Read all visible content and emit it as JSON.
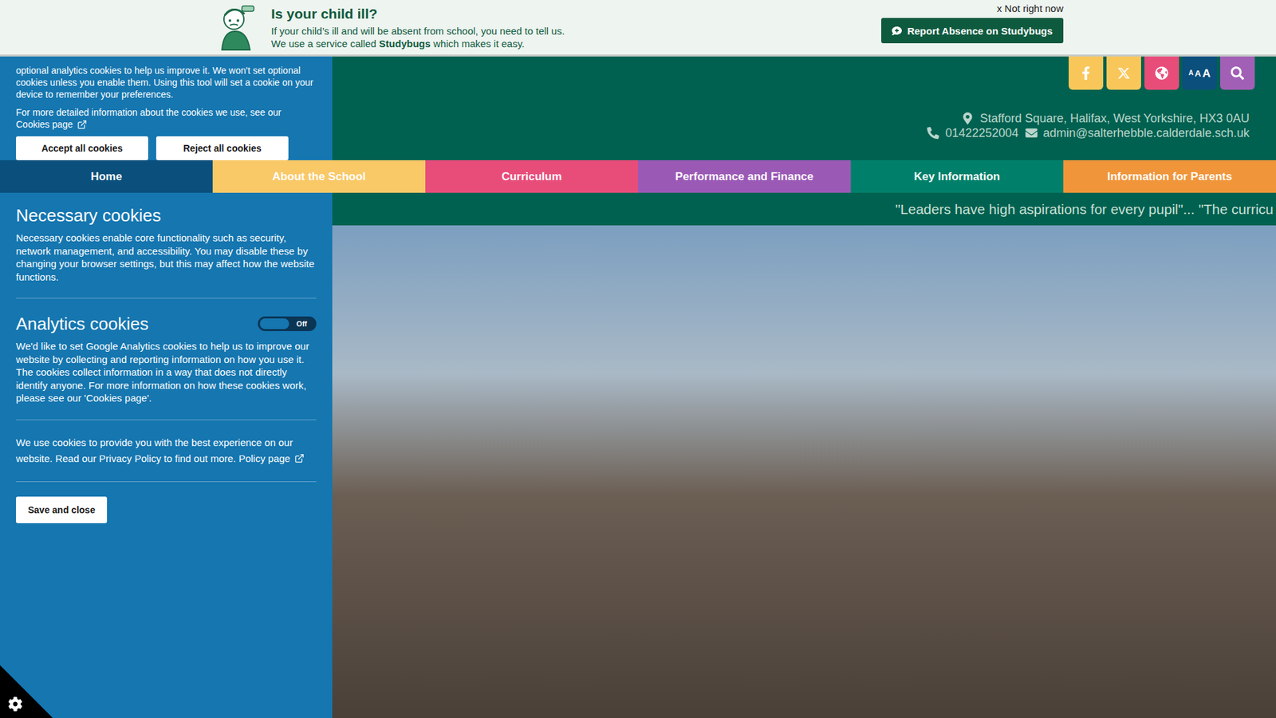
{
  "banner": {
    "title": "Is your child ill?",
    "line1": "If your child’s ill and will be absent from school, you need to tell us.",
    "line2_before": "We use a service called ",
    "line2_bold": "Studybugs",
    "line2_after": " which makes it easy.",
    "dismiss": "x Not right now",
    "button": "Report Absence on Studybugs"
  },
  "header": {
    "tools": [
      {
        "kind": "facebook",
        "color": "#f9c65a"
      },
      {
        "kind": "x",
        "color": "#f9c65a"
      },
      {
        "kind": "globe",
        "color": "#e84d7a"
      },
      {
        "kind": "text-size",
        "color": "#0b4f7c",
        "labels": [
          "A",
          "A",
          "A"
        ]
      },
      {
        "kind": "search",
        "color": "#a160b5"
      }
    ],
    "address": "Stafford Square, Halifax, West Yorkshire, HX3 0AU",
    "phone": "01422252004",
    "email": "admin@salterhebble.calderdale.sch.uk"
  },
  "nav": [
    {
      "label": "Home",
      "color": "#0b4f7c"
    },
    {
      "label": "About the School",
      "color": "#f9c867"
    },
    {
      "label": "Curriculum",
      "color": "#e84d7a"
    },
    {
      "label": "Performance and Finance",
      "color": "#9b59b6"
    },
    {
      "label": "Key Information",
      "color": "#00806a"
    },
    {
      "label": "Information for Parents",
      "color": "#f0953a"
    }
  ],
  "ticker": "\"Leaders have high aspirations for every pupil\"... \"The curricu",
  "cookie_panel": {
    "intro": "optional analytics cookies to help us improve it. We won't set optional cookies unless you enable them. Using this tool will set a cookie on your device to remember your preferences.",
    "more_info": "For more detailed information about the cookies we use, see our ",
    "more_info_link": "Cookies page",
    "buttons": [
      "Accept all cookies",
      "Reject all cookies"
    ],
    "sections": [
      {
        "kind": "plain",
        "title": "Necessary cookies",
        "text": "Necessary cookies enable core functionality such as security, network management, and accessibility. You may disable these by changing your browser settings, but this may affect how the website functions."
      },
      {
        "kind": "toggle",
        "title": "Analytics cookies",
        "on": false,
        "toggle_label": "Off",
        "text": "We'd like to set Google Analytics cookies to help us to improve our website by collecting and reporting information on how you use it. The cookies collect information in a way that does not directly identify anyone. For more information on how these cookies work, please see our 'Cookies page'."
      }
    ],
    "policy_text": "We use cookies to provide you with the best experience on our website. Read our Privacy Policy to find out more. ",
    "policy_link": "Policy page",
    "save": "Save and close"
  }
}
